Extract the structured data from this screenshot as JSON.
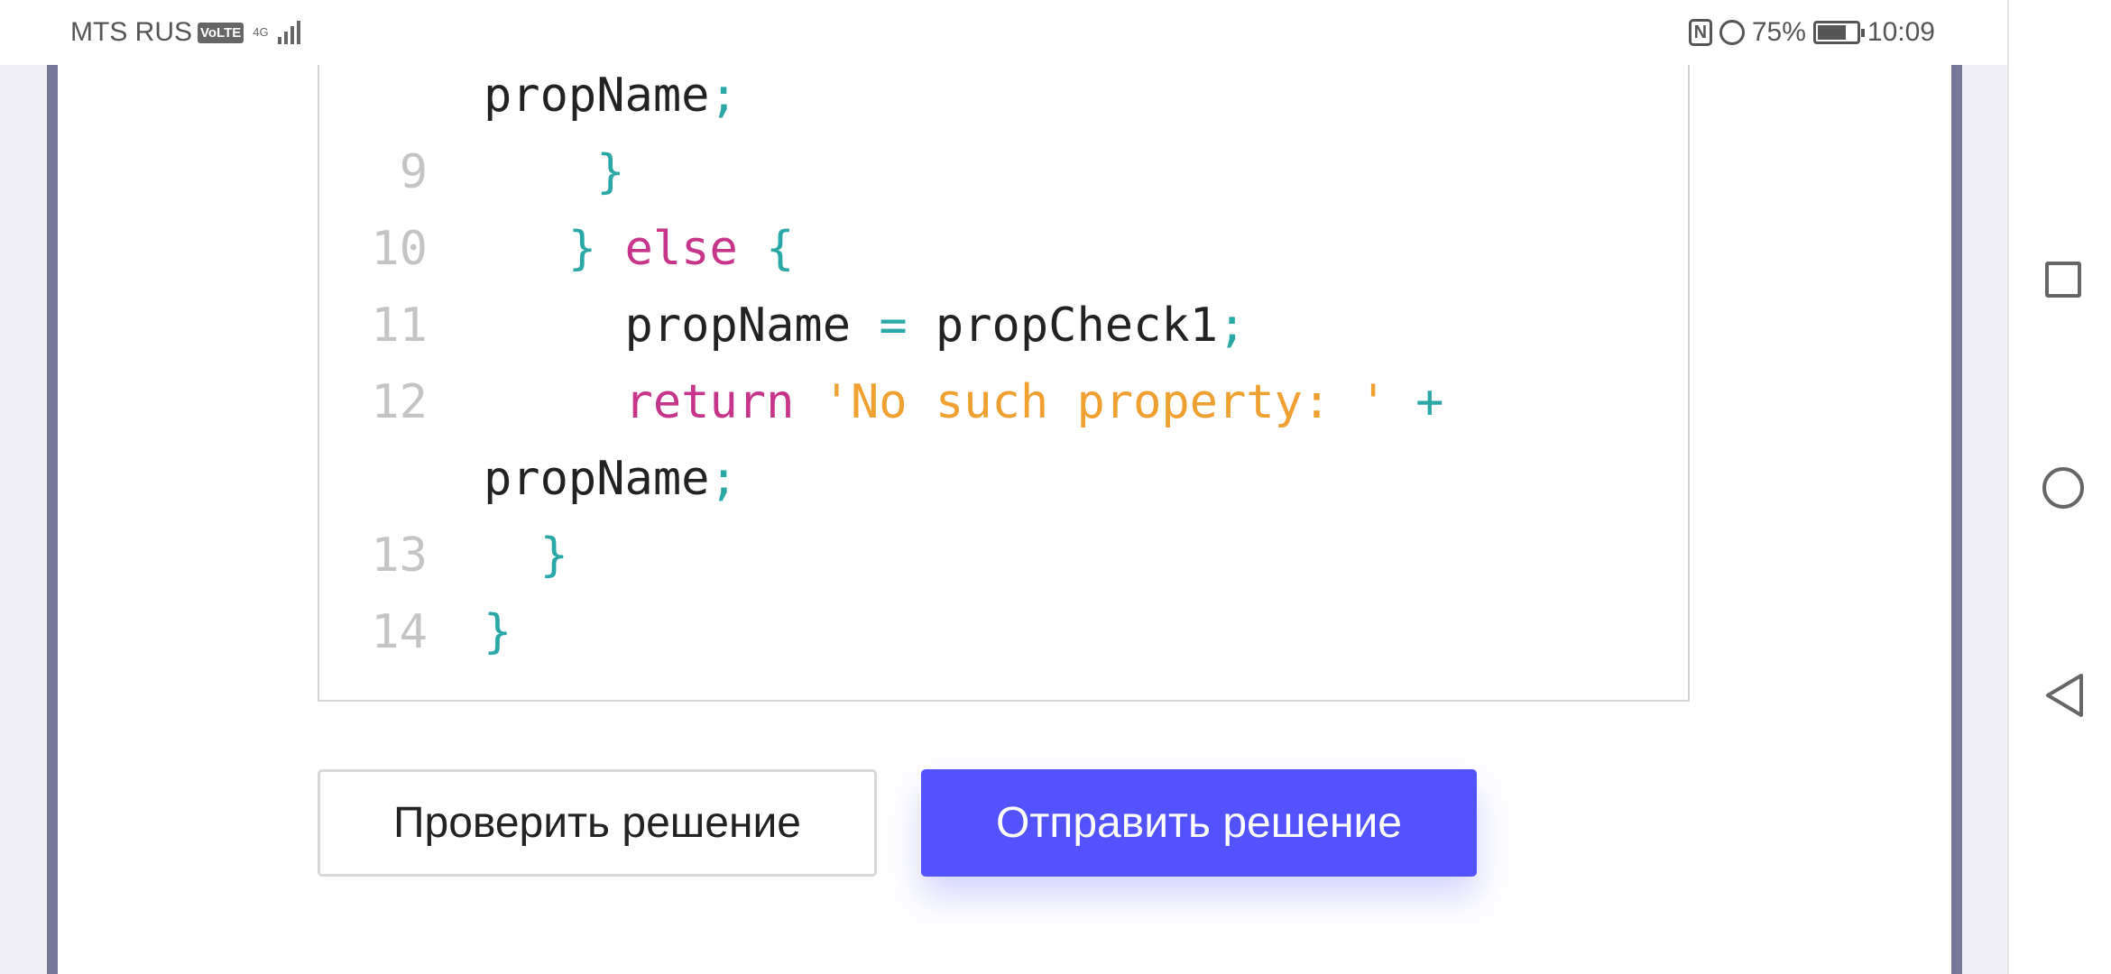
{
  "status_bar": {
    "carrier": "MTS RUS",
    "volte": "VoLTE",
    "network": "4G",
    "battery_percent": "75%",
    "battery_level": 75,
    "time": "10:09",
    "nfc": "N"
  },
  "code": {
    "lines": [
      {
        "num": "",
        "indent": "",
        "tokens": [
          {
            "t": "propName",
            "c": ""
          },
          {
            "t": ";",
            "c": "pn"
          }
        ]
      },
      {
        "num": "9",
        "indent": "    ",
        "tokens": [
          {
            "t": "}",
            "c": "pn"
          }
        ]
      },
      {
        "num": "10",
        "indent": "   ",
        "tokens": [
          {
            "t": "} ",
            "c": "pn"
          },
          {
            "t": "else",
            "c": "kw"
          },
          {
            "t": " {",
            "c": "pn"
          }
        ]
      },
      {
        "num": "11",
        "indent": "     ",
        "tokens": [
          {
            "t": "propName ",
            "c": ""
          },
          {
            "t": "=",
            "c": "pn"
          },
          {
            "t": " propCheck1",
            "c": ""
          },
          {
            "t": ";",
            "c": "pn"
          }
        ]
      },
      {
        "num": "12",
        "indent": "     ",
        "tokens": [
          {
            "t": "return",
            "c": "kw"
          },
          {
            "t": " 'No such property: '",
            "c": "str"
          },
          {
            "t": " +",
            "c": "pn"
          }
        ]
      },
      {
        "num": "",
        "indent": "",
        "tokens": [
          {
            "t": "propName",
            "c": ""
          },
          {
            "t": ";",
            "c": "pn"
          }
        ]
      },
      {
        "num": "13",
        "indent": "  ",
        "tokens": [
          {
            "t": "}",
            "c": "pn"
          }
        ]
      },
      {
        "num": "14",
        "indent": "",
        "tokens": [
          {
            "t": "}",
            "c": "pn"
          }
        ]
      }
    ]
  },
  "buttons": {
    "check": "Проверить решение",
    "submit": "Отправить решение"
  },
  "colors": {
    "accent": "#5252ff",
    "keyword": "#c7358b",
    "string": "#f0a030",
    "punct": "#2aa8a8"
  }
}
